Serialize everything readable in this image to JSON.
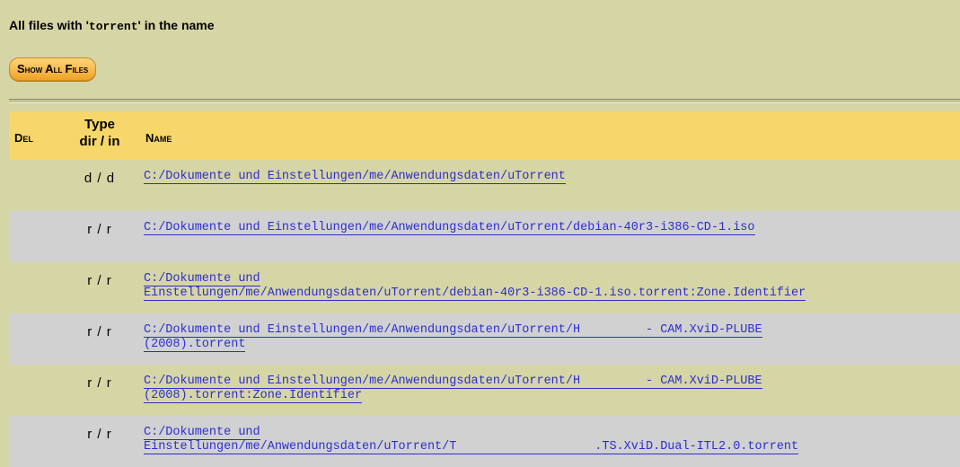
{
  "header": {
    "title_prefix": "All files with '",
    "title_term": "torrent",
    "title_suffix": "' in the name"
  },
  "toolbar": {
    "show_all_first": "S",
    "show_all_rest": "how ",
    "show_all_first2": "A",
    "show_all_rest2": "ll ",
    "show_all_first3": "F",
    "show_all_rest3": "iles"
  },
  "table": {
    "col_del": "Del",
    "col_type_line1": "Type",
    "col_type_line2": "dir / in",
    "col_name": "Name",
    "rows": [
      {
        "type": "d / d",
        "line1": "C:/Dokumente und Einstellungen/me/Anwendungsdaten/uTorrent",
        "line2": ""
      },
      {
        "type": "r / r",
        "line1": "C:/Dokumente und Einstellungen/me/Anwendungsdaten/uTorrent/debian-40r3-i386-CD-1.iso",
        "line2": ""
      },
      {
        "type": "r / r",
        "line1": "C:/Dokumente und",
        "line2": "Einstellungen/me/Anwendungsdaten/uTorrent/debian-40r3-i386-CD-1.iso.torrent:Zone.Identifier"
      },
      {
        "type": "r / r",
        "line1": "C:/Dokumente und Einstellungen/me/Anwendungsdaten/uTorrent/H         - CAM.XviD-PLUBE",
        "line2": "(2008).torrent"
      },
      {
        "type": "r / r",
        "line1": "C:/Dokumente und Einstellungen/me/Anwendungsdaten/uTorrent/H         - CAM.XviD-PLUBE",
        "line2": "(2008).torrent:Zone.Identifier"
      },
      {
        "type": "r / r",
        "line1": "C:/Dokumente und",
        "line2": "Einstellungen/me/Anwendungsdaten/uTorrent/T                   .TS.XviD.Dual-ITL2.0.torrent"
      }
    ]
  }
}
